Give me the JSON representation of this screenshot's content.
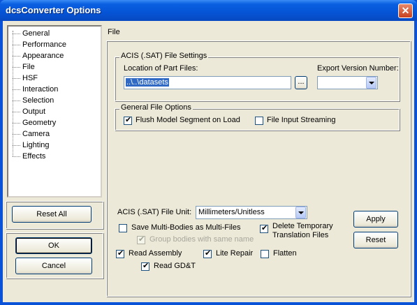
{
  "window": {
    "title": "dcsConverter Options",
    "close_symbol": "✕"
  },
  "tree": {
    "items": [
      "General",
      "Performance",
      "Appearance",
      "File",
      "HSF",
      "Interaction",
      "Selection",
      "Output",
      "Geometry",
      "Camera",
      "Lighting",
      "Effects"
    ]
  },
  "buttons": {
    "reset_all": "Reset All",
    "ok": "OK",
    "cancel": "Cancel",
    "apply": "Apply",
    "reset": "Reset"
  },
  "panel": {
    "header": "File",
    "acis_group": {
      "title": "ACIS (.SAT) File Settings",
      "location_label": "Location of Part Files:",
      "location_value": "..\\..\\datasets",
      "browse_label": "...",
      "export_label": "Export Version Number:",
      "export_value": ""
    },
    "general_group": {
      "title": "General File Options",
      "flush_label": "Flush Model Segment on Load",
      "flush_checked": true,
      "streaming_label": "File Input Streaming",
      "streaming_checked": false
    },
    "unit": {
      "label": "ACIS (.SAT) File Unit:",
      "value": "Millimeters/Unitless"
    },
    "options": {
      "save_multi": {
        "label": "Save Multi-Bodies as Multi-Files",
        "checked": false
      },
      "group_bodies": {
        "label": "Group bodies with same name",
        "checked": true,
        "disabled": true
      },
      "delete_temp": {
        "label_line1": "Delete Temporary",
        "label_line2": "Translation Files",
        "checked": true
      },
      "read_assembly": {
        "label": "Read Assembly",
        "checked": true
      },
      "lite_repair": {
        "label": "Lite Repair",
        "checked": true
      },
      "flatten": {
        "label": "Flatten",
        "checked": false
      },
      "read_gdt": {
        "label": "Read GD&T",
        "checked": true
      }
    }
  }
}
